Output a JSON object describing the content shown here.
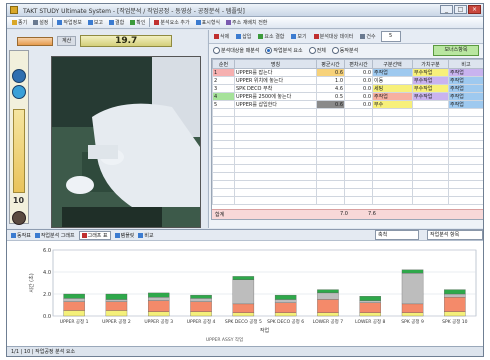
{
  "window": {
    "title": "TAKT STUDY Ultimate System - [작업분석 / 작업공정 - 동영상 - 공정분석 - 템플릿]"
  },
  "toolbar": {
    "items": [
      {
        "label": "종기",
        "icon": "folder-icon",
        "color": "#d9a728"
      },
      {
        "label": "설정",
        "icon": "gear-icon",
        "color": "#6a7a90"
      },
      {
        "label": "작업정보",
        "icon": "doc-icon",
        "color": "#3b7bd0"
      },
      {
        "label": "보고",
        "icon": "report-icon",
        "color": "#3b7bd0"
      },
      {
        "label": "결합",
        "icon": "merge-icon",
        "color": "#3b7bd0"
      },
      {
        "label": "확인",
        "icon": "check-icon",
        "color": "#3b9a3b"
      },
      {
        "label": "분석요소 추가",
        "icon": "add-icon",
        "color": "#c03030"
      },
      {
        "label": "표시형식",
        "icon": "view-icon",
        "color": "#3b7bd0"
      },
      {
        "label": "주소 재배치 전환",
        "icon": "switch-icon",
        "color": "#7a5ab0"
      }
    ]
  },
  "left": {
    "label": "계산",
    "value": "19.7",
    "counter": "10"
  },
  "right": {
    "toolbar": [
      {
        "label": "삭제",
        "icon": "delete-icon",
        "color": "#c03030"
      },
      {
        "label": "삽입",
        "icon": "insert-icon",
        "color": "#3b7bd0"
      },
      {
        "label": "요소 결합",
        "icon": "merge-icon",
        "color": "#3b9a3b"
      },
      {
        "label": "보기",
        "icon": "view-icon",
        "color": "#3b7bd0"
      },
      {
        "label": "분석대상 데이터",
        "icon": "data-icon",
        "color": "#c03030"
      },
      {
        "label": "건수",
        "icon": "count-icon",
        "color": "#6a7a90"
      }
    ],
    "count": "5",
    "radios": [
      {
        "label": "분석대상을 때분석",
        "on": false
      },
      {
        "label": "작업분석 요소",
        "on": true
      },
      {
        "label": "전체",
        "on": false
      },
      {
        "label": "동작분석",
        "on": false
      }
    ],
    "green_button": "보너스항목",
    "headers": [
      "순번",
      "명칭",
      "평균시간",
      "편차시간",
      "구분선택",
      "가치구분",
      "비고"
    ],
    "rows": [
      {
        "cells": [
          "1",
          "UPPER를 잡는다",
          "0.6",
          "0.0",
          "주작업",
          "부수작업",
          "주작업"
        ],
        "colors": [
          "#f6b0b0",
          "#ffffff",
          "#f7d27a",
          "#ffffff",
          "#9ec9ef",
          "#f7f07a",
          "#c9b3ef"
        ]
      },
      {
        "cells": [
          "2",
          "UPPER 위치에 놓는다",
          "1.0",
          "0.0",
          "이동",
          "부수작업",
          "주작업"
        ],
        "colors": [
          "#ffffff",
          "#ffffff",
          "#ffffff",
          "#ffffff",
          "#ffffff",
          "#c9b3ef",
          "#9ec9ef"
        ]
      },
      {
        "cells": [
          "3",
          "SPK DECO 부착",
          "4.6",
          "0.0",
          "세팅",
          "부수작업",
          "주작업"
        ],
        "colors": [
          "#ffffff",
          "#ffffff",
          "#ffffff",
          "#ffffff",
          "#f7f07a",
          "#f7f07a",
          "#9ec9ef"
        ]
      },
      {
        "cells": [
          "4",
          "UPPER를 2500에 놓는다",
          "0.5",
          "0.0",
          "주작업",
          "부수작업",
          "주작업"
        ],
        "colors": [
          "#a6e29a",
          "#ffffff",
          "#ffffff",
          "#ffffff",
          "#f7b0a0",
          "#c9b3ef",
          "#9ec9ef"
        ]
      },
      {
        "cells": [
          "5",
          "UPPER를 삽입한다",
          "0.6",
          "0.0",
          "부수",
          "",
          "주작업"
        ],
        "colors": [
          "#ffffff",
          "#ffffff",
          "#8a8a8a",
          "#ffffff",
          "#f7f07a",
          "#ffffff",
          "#9ec9ef"
        ]
      }
    ],
    "footer": {
      "label": "합계",
      "v1": "7.0",
      "v2": "7.6"
    }
  },
  "bottom": {
    "tabs": [
      {
        "label": "동작표",
        "active": false
      },
      {
        "label": "작업분석 그래프",
        "active": false
      },
      {
        "label": "그래프 표",
        "active": true
      },
      {
        "label": "템플릿",
        "active": false
      },
      {
        "label": "비교",
        "active": false
      }
    ],
    "combo1": "축척",
    "combo2": "작업분석 항목"
  },
  "chart_data": {
    "type": "bar",
    "stacked": true,
    "categories": [
      "UPPER 공정 1",
      "UPPER 공정 2",
      "UPPER 공정 3",
      "UPPER 공정 4",
      "SPK DECO 공정 5",
      "SPK DECO 공정 6",
      "LOWER 공정 7",
      "LOWER 공정 8",
      "SPK 공정 9",
      "SPK 공정 10"
    ],
    "series": [
      {
        "values": [
          0.5,
          0.5,
          0.4,
          0.4,
          0.3,
          0.3,
          0.3,
          0.3,
          0.3,
          0.4
        ],
        "color": "#f4f07a"
      },
      {
        "values": [
          0.8,
          0.8,
          1.0,
          0.9,
          0.8,
          0.9,
          1.2,
          0.9,
          0.8,
          1.3
        ],
        "color": "#f48a6a"
      },
      {
        "values": [
          0.3,
          0.2,
          0.3,
          0.3,
          2.2,
          0.3,
          0.6,
          0.2,
          2.8,
          0.3
        ],
        "color": "#bdbdbd"
      },
      {
        "values": [
          0.4,
          0.5,
          0.4,
          0.3,
          0.3,
          0.4,
          0.3,
          0.4,
          0.3,
          0.4
        ],
        "color": "#2ea84a"
      }
    ],
    "ylabel": "시간 (초)",
    "xlabel": "작업",
    "ylim": [
      0,
      6
    ],
    "yticks": [
      "6.0",
      "4.0",
      "2.0",
      "0.0"
    ],
    "grid": true,
    "footnote": "UPPER ASSY 작업"
  },
  "status": {
    "text": "1/1 | 10 | 작업공정 분석 요소"
  }
}
